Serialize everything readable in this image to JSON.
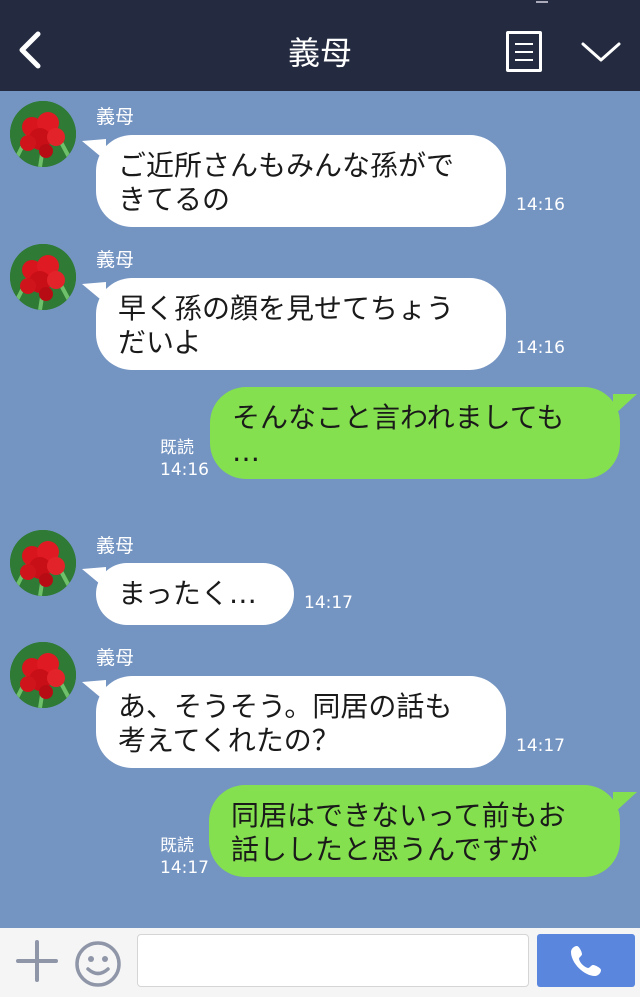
{
  "header": {
    "title": "義母",
    "back_icon": "chevron-left-icon",
    "menu_icon": "menu-icon",
    "collapse_icon": "chevron-down-icon"
  },
  "colors": {
    "header_bg": "#242b40",
    "chat_bg": "#7494c2",
    "incoming_bubble": "#ffffff",
    "outgoing_bubble": "#84e04e",
    "send_button": "#5a86de"
  },
  "messages": [
    {
      "sender": "義母",
      "text_lines": [
        "ご近所さんもみんな孫がで",
        "きてるの"
      ],
      "time": "14:16"
    },
    {
      "sender": "義母",
      "text_lines": [
        "早く孫の顔を見せてちょう",
        "だいよ"
      ],
      "time": "14:16"
    },
    {
      "sender": "me",
      "text_lines": [
        "そんなこと言われましても",
        "…"
      ],
      "read": "既読",
      "time": "14:16"
    },
    {
      "sender": "義母",
      "text_lines": [
        "まったく…"
      ],
      "time": "14:17"
    },
    {
      "sender": "義母",
      "text_lines": [
        "あ、そうそう。同居の話も",
        "考えてくれたの？"
      ],
      "time": "14:17"
    },
    {
      "sender": "me",
      "text_lines": [
        "同居はできないって前もお",
        "話ししたと思うんですが"
      ],
      "read": "既読",
      "time": "14:17"
    }
  ],
  "footer": {
    "plus_icon": "plus-icon",
    "sticker_icon": "smiley-icon",
    "input_value": "",
    "send_icon": "phone-icon"
  }
}
